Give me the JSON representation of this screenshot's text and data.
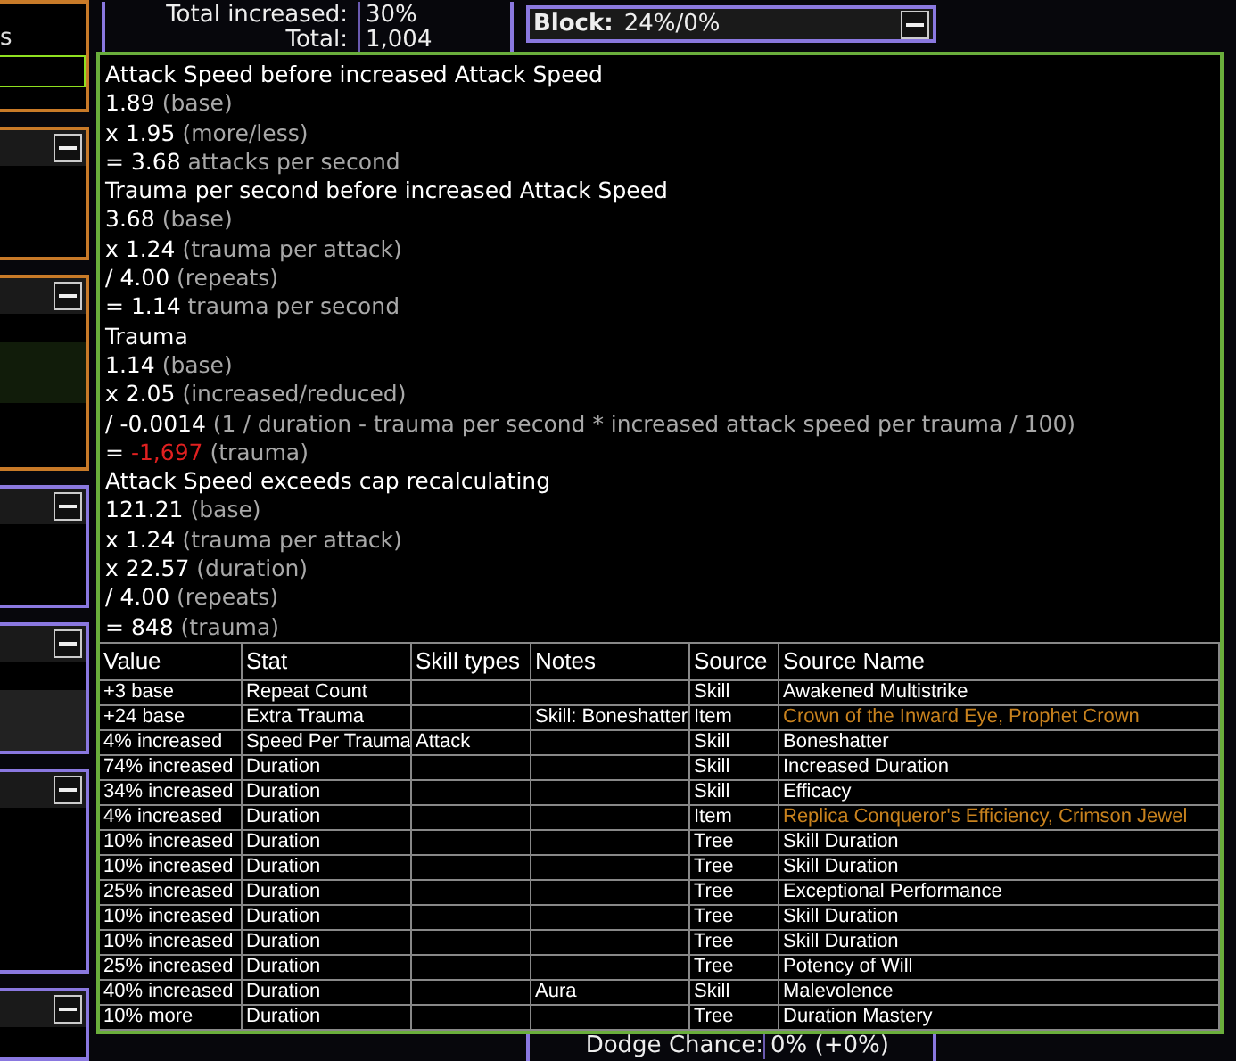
{
  "left_panels": [
    {
      "color": "#c87a28",
      "text": "s",
      "field": true
    },
    {
      "color": "#c87a28",
      "expanded": true
    },
    {
      "color": "#c87a28",
      "expanded": true,
      "highlighted": true
    },
    {
      "color": "#8a78e0",
      "expanded": true
    },
    {
      "color": "#8a78e0",
      "expanded": true,
      "highlighted": true
    },
    {
      "color": "#8a78e0",
      "expanded": true
    },
    {
      "color": "#8a78e0",
      "expanded": true
    }
  ],
  "totals": [
    {
      "label": "Total increased:",
      "value": "30%"
    },
    {
      "label": "Total:",
      "value": "1,004"
    }
  ],
  "block": {
    "title": "Block:",
    "value": "24%/0%",
    "expanded": true
  },
  "dodge": {
    "label": "Dodge Chance:",
    "value": "0% (+0%)"
  },
  "tooltip": {
    "lines": [
      {
        "kind": "heading",
        "text": "Attack Speed before increased Attack Speed"
      },
      {
        "kind": "step",
        "value": "1.89",
        "note": "(base)"
      },
      {
        "kind": "step",
        "op": "x",
        "value": "1.95",
        "note": "(more/less)"
      },
      {
        "kind": "step",
        "op": "=",
        "value": "3.68",
        "note": "attacks per second"
      },
      {
        "kind": "heading",
        "text": "Trauma per second before increased Attack Speed"
      },
      {
        "kind": "step",
        "value": "3.68",
        "note": "(base)"
      },
      {
        "kind": "step",
        "op": "x",
        "value": "1.24",
        "note": "(trauma per attack)"
      },
      {
        "kind": "step",
        "op": "/",
        "value": "4.00",
        "note": "(repeats)"
      },
      {
        "kind": "step",
        "op": "=",
        "value": "1.14",
        "note": "trauma per second"
      },
      {
        "kind": "heading",
        "text": "Trauma"
      },
      {
        "kind": "step",
        "value": "1.14",
        "note": "(base)"
      },
      {
        "kind": "step",
        "op": "x",
        "value": "2.05",
        "note": "(increased/reduced)"
      },
      {
        "kind": "step",
        "op": "/",
        "value": "-0.0014",
        "note": "(1 / duration - trauma per second * increased attack speed per trauma / 100)"
      },
      {
        "kind": "step",
        "op": "=",
        "value": "-1,697",
        "note": "(trauma)",
        "negative": true
      },
      {
        "kind": "heading",
        "text": "Attack Speed exceeds cap recalculating"
      },
      {
        "kind": "step",
        "value": "121.21",
        "note": "(base)"
      },
      {
        "kind": "step",
        "op": "x",
        "value": "1.24",
        "note": "(trauma per attack)"
      },
      {
        "kind": "step",
        "op": "x",
        "value": "22.57",
        "note": "(duration)"
      },
      {
        "kind": "step",
        "op": "/",
        "value": "4.00",
        "note": "(repeats)"
      },
      {
        "kind": "step",
        "op": "=",
        "value": "848",
        "note": "(trauma)"
      }
    ],
    "table": {
      "columns": [
        "Value",
        "Stat",
        "Skill types",
        "Notes",
        "Source",
        "Source Name"
      ],
      "rows": [
        {
          "value": "+3 base",
          "stat": "Repeat Count",
          "skill_types": "",
          "notes": "",
          "source": "Skill",
          "source_name": "Awakened Multistrike",
          "unique": false
        },
        {
          "value": "+24 base",
          "stat": "Extra Trauma",
          "skill_types": "",
          "notes": "Skill: Boneshatter",
          "source": "Item",
          "source_name": "Crown of the Inward Eye, Prophet Crown",
          "unique": true
        },
        {
          "value": "4% increased",
          "stat": "Speed Per Trauma",
          "skill_types": "Attack",
          "notes": "",
          "source": "Skill",
          "source_name": "Boneshatter",
          "unique": false
        },
        {
          "value": "74% increased",
          "stat": "Duration",
          "skill_types": "",
          "notes": "",
          "source": "Skill",
          "source_name": "Increased Duration",
          "unique": false
        },
        {
          "value": "34% increased",
          "stat": "Duration",
          "skill_types": "",
          "notes": "",
          "source": "Skill",
          "source_name": "Efficacy",
          "unique": false
        },
        {
          "value": "4% increased",
          "stat": "Duration",
          "skill_types": "",
          "notes": "",
          "source": "Item",
          "source_name": "Replica Conqueror's Efficiency, Crimson Jewel",
          "unique": true
        },
        {
          "value": "10% increased",
          "stat": "Duration",
          "skill_types": "",
          "notes": "",
          "source": "Tree",
          "source_name": "Skill Duration",
          "unique": false
        },
        {
          "value": "10% increased",
          "stat": "Duration",
          "skill_types": "",
          "notes": "",
          "source": "Tree",
          "source_name": "Skill Duration",
          "unique": false
        },
        {
          "value": "25% increased",
          "stat": "Duration",
          "skill_types": "",
          "notes": "",
          "source": "Tree",
          "source_name": "Exceptional Performance",
          "unique": false
        },
        {
          "value": "10% increased",
          "stat": "Duration",
          "skill_types": "",
          "notes": "",
          "source": "Tree",
          "source_name": "Skill Duration",
          "unique": false
        },
        {
          "value": "10% increased",
          "stat": "Duration",
          "skill_types": "",
          "notes": "",
          "source": "Tree",
          "source_name": "Skill Duration",
          "unique": false
        },
        {
          "value": "25% increased",
          "stat": "Duration",
          "skill_types": "",
          "notes": "",
          "source": "Tree",
          "source_name": "Potency of Will",
          "unique": false
        },
        {
          "value": "40% increased",
          "stat": "Duration",
          "skill_types": "",
          "notes": "Aura",
          "source": "Skill",
          "source_name": "Malevolence",
          "unique": false
        },
        {
          "value": "10% more",
          "stat": "Duration",
          "skill_types": "",
          "notes": "",
          "source": "Tree",
          "source_name": "Duration Mastery",
          "unique": false
        }
      ]
    }
  }
}
